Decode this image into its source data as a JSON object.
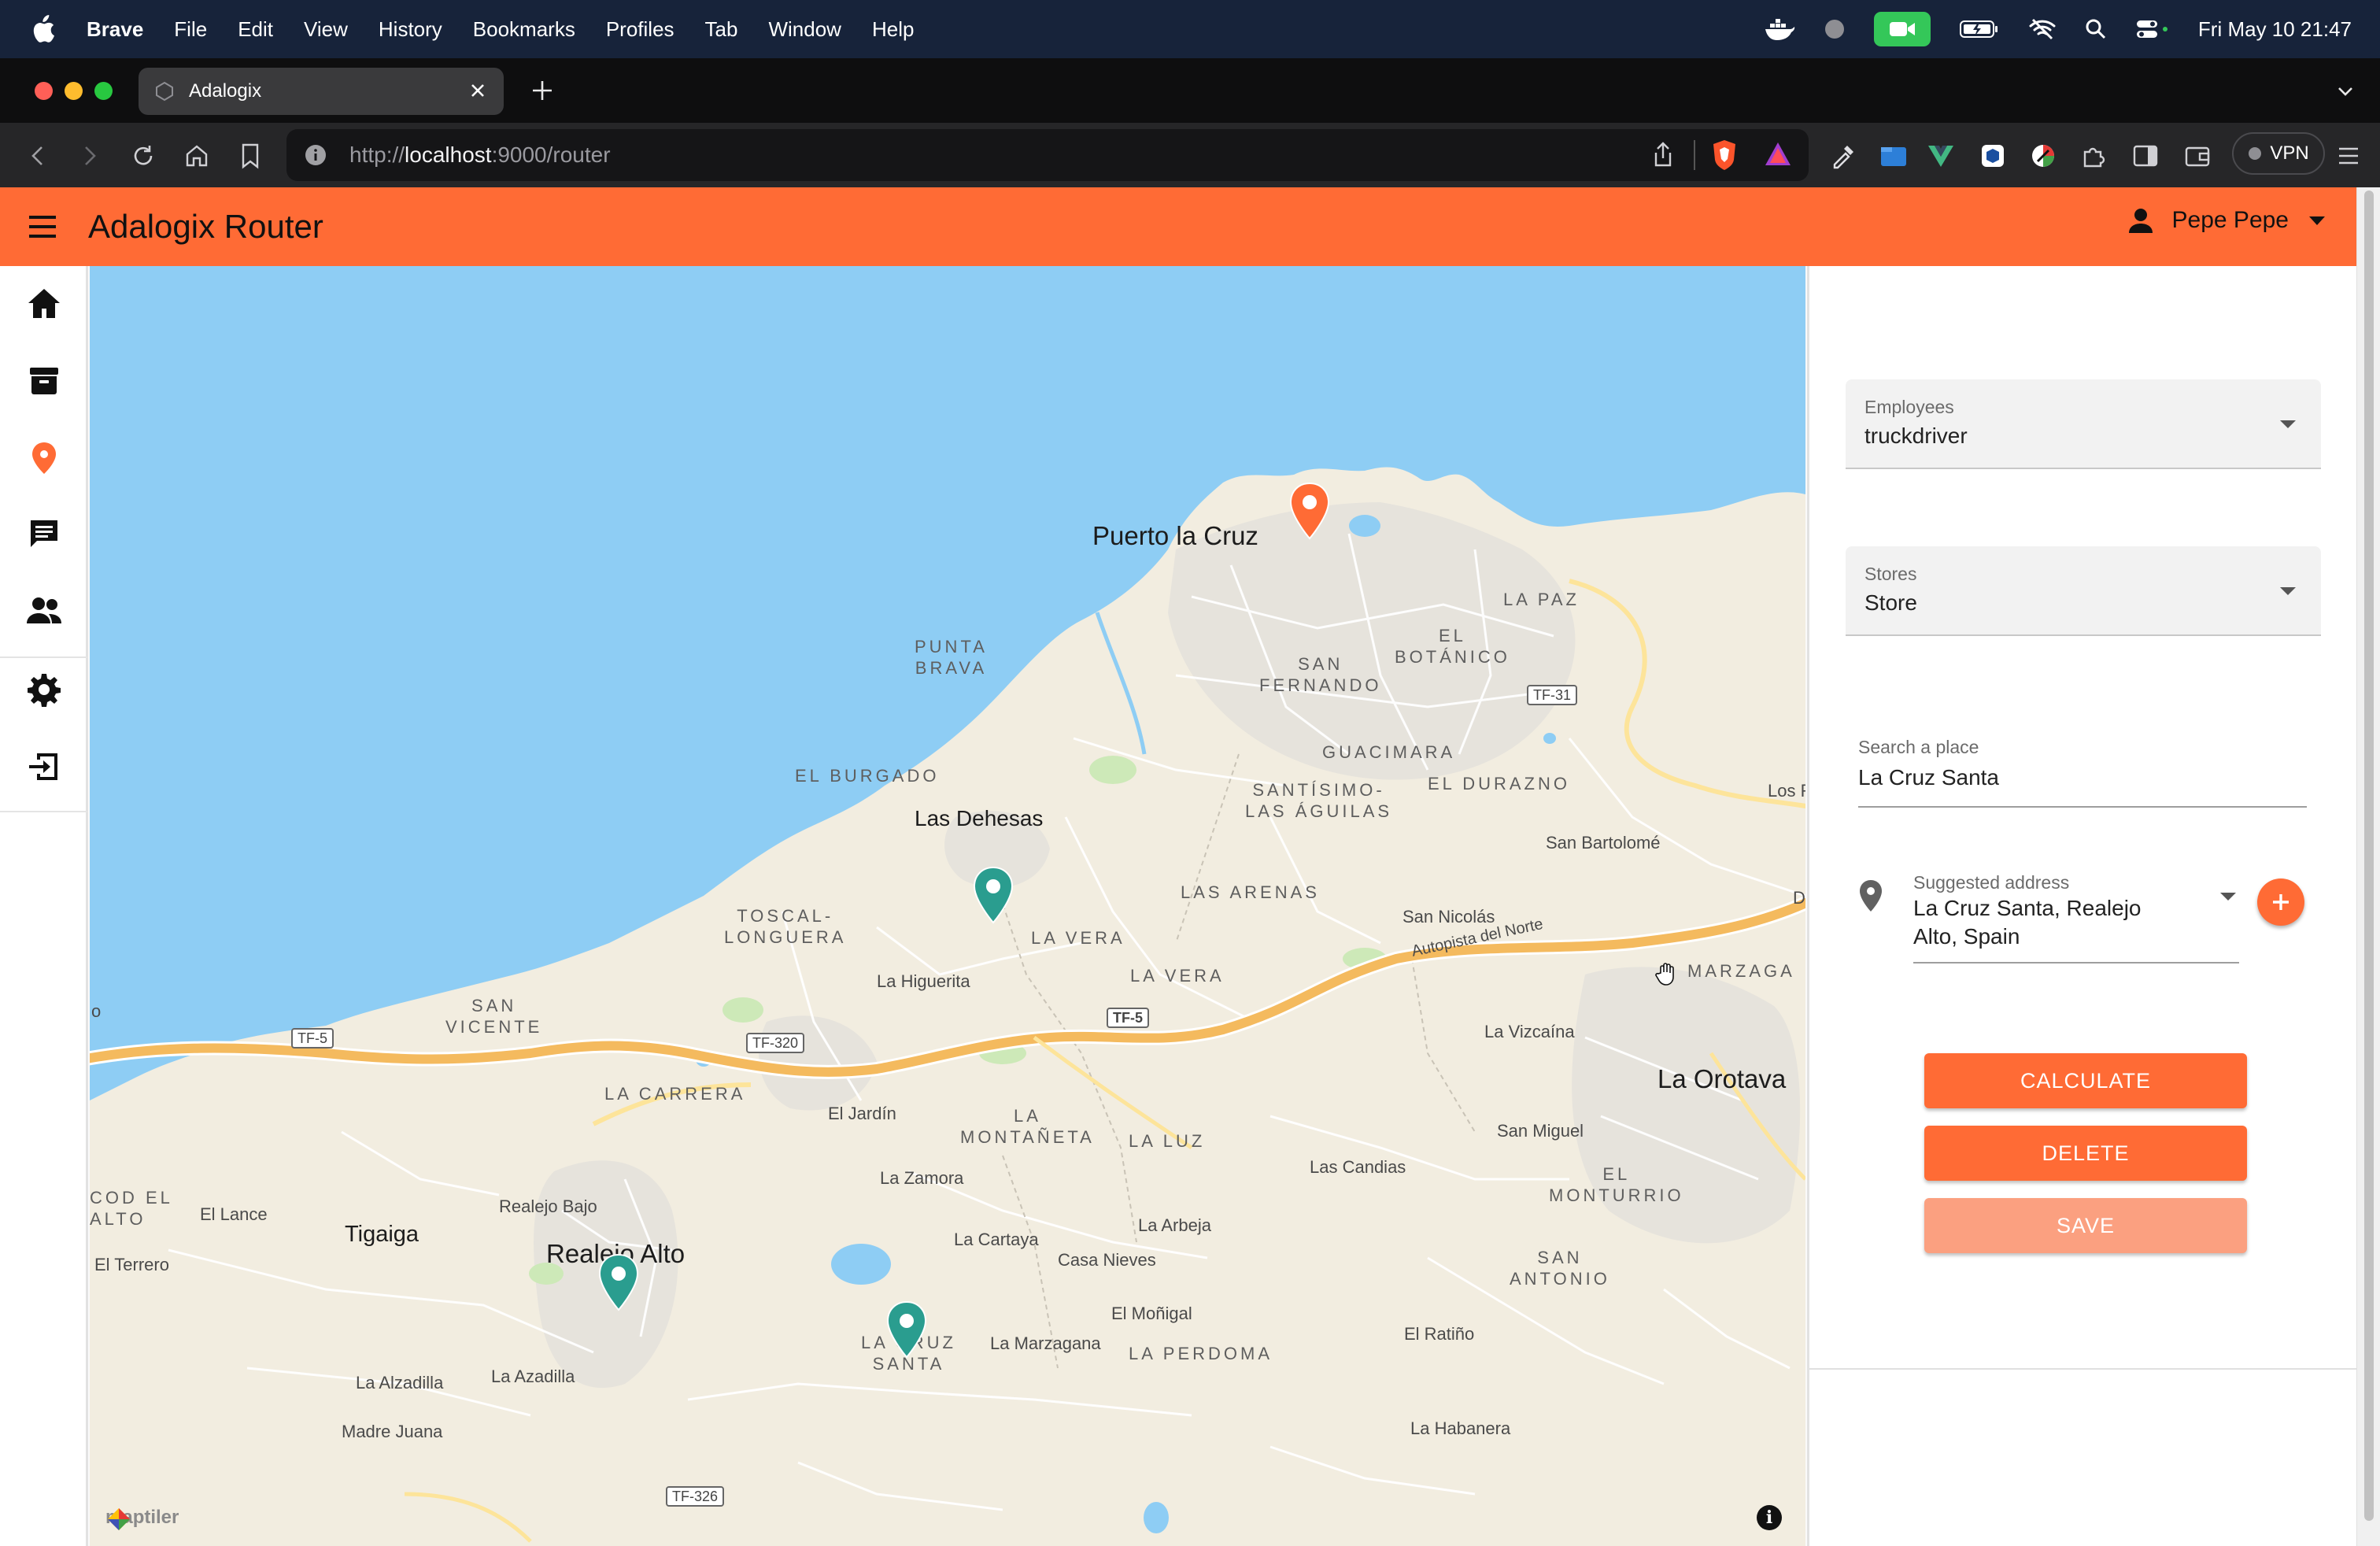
{
  "menubar": {
    "app_name": "Brave",
    "items": [
      "File",
      "Edit",
      "View",
      "History",
      "Bookmarks",
      "Profiles",
      "Tab",
      "Window",
      "Help"
    ],
    "clock": "Fri May 10  21:47"
  },
  "browser": {
    "tab_title": "Adalogix",
    "url_scheme": "http://",
    "url_host": "localhost",
    "url_rest": ":9000/router",
    "vpn_label": "VPN"
  },
  "app": {
    "title": "Adalogix Router",
    "user_name": "Pepe Pepe",
    "nav": [
      "home-icon",
      "archive-icon",
      "location-pin-icon",
      "chat-icon",
      "people-icon",
      "gear-icon",
      "logout-icon"
    ],
    "colors": {
      "accent": "#ff6b35",
      "accent_light": "#fba080",
      "marker_stop": "#2a9d8f",
      "marker_origin": "#ff6b35"
    }
  },
  "panel": {
    "employees": {
      "label": "Employees",
      "value": "truckdriver"
    },
    "stores": {
      "label": "Stores",
      "value": "Store"
    },
    "search": {
      "label": "Search a place",
      "value": "La Cruz Santa"
    },
    "suggested": {
      "label": "Suggested address",
      "value": "La Cruz Santa, Realejo Alto, Spain"
    },
    "buttons": {
      "calculate": "CALCULATE",
      "delete": "DELETE",
      "save": "SAVE"
    }
  },
  "map": {
    "attribution": "maptiler",
    "labels": {
      "puerto_la_cruz": "Puerto la Cruz",
      "punta_brava_1": "PUNTA",
      "punta_brava_2": "BRAVA",
      "la_paz": "LA PAZ",
      "el_botanico_1": "EL",
      "el_botanico_2": "BOTÁNICO",
      "san_fernando_1": "SAN",
      "san_fernando_2": "FERNANDO",
      "guacimara": "GUACIMARA",
      "el_burgado": "EL BURGADO",
      "santisimo_1": "SANTÍSIMO-",
      "santisimo_2": "LAS ÁGUILAS",
      "el_durazno": "EL DURAZNO",
      "los_r": "Los R",
      "las_dehesas": "Las Dehesas",
      "san_bartolome": "San Bartolomé",
      "toscal_1": "TOSCAL-",
      "toscal_2": "LONGUERA",
      "la_vera_upper": "LA VERA",
      "las_arenas": "LAS ARENAS",
      "san_nicolas": "San Nicolás",
      "la_vera": "LA VERA",
      "la_higuerita": "La Higuerita",
      "autopista": "Autopista del Norte",
      "marzagan": "MARZAGA",
      "d_cut": "D",
      "san_vicente_1": "SAN",
      "san_vicente_2": "VICENTE",
      "o_cut": "o",
      "la_carrera": "LA CARRERA",
      "la_vizcaina": "La Vizcaína",
      "la_orotava": "La Orotava",
      "el_jardin": "El Jardín",
      "la_montaneta_1": "LA",
      "la_montaneta_2": "MONTAÑETA",
      "la_luz": "LA LUZ",
      "san_miguel": "San Miguel",
      "las_candias": "Las Candias",
      "la_zamora": "La Zamora",
      "el_monturrio_1": "EL",
      "el_monturrio_2": "MONTURRIO",
      "cod_el_alto_1": "COD EL",
      "cod_el_alto_2": "ALTO",
      "el_lance": "El Lance",
      "realejo_bajo": "Realejo Bajo",
      "tigaiga": "Tigaiga",
      "la_arbeja": "La Arbeja",
      "el_terrero": "El Terrero",
      "realejo_alto": "Realejo Alto",
      "la_cartaya": "La Cartaya",
      "casa_nieves": "Casa Nieves",
      "san_antonio_1": "SAN",
      "san_antonio_2": "ANTONIO",
      "el_monigal": "El Moñigal",
      "la_cruz_santa_1": "LA CRUZ",
      "la_cruz_santa_2": "SANTA",
      "la_marzagana": "La Marzagana",
      "la_perdoma": "LA PERDOMA",
      "el_ratino": "El Ratiño",
      "la_alzadilla": "La Alzadilla",
      "la_azadilla": "La Azadilla",
      "madre_juana": "Madre Juana",
      "la_habanera": "La Habanera"
    },
    "roads": {
      "tf5_a": "TF-5",
      "tf5_b": "TF-5",
      "tf320": "TF-320",
      "tf31": "TF-31",
      "tf326": "TF-326"
    }
  }
}
